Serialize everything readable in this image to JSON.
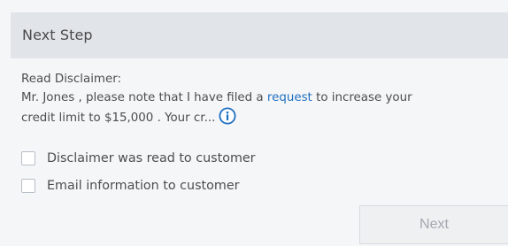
{
  "header": {
    "title": "Next Step"
  },
  "disclaimer": {
    "label": "Read Disclaimer:",
    "text_part1": "Mr. Jones , please note that I have filed a ",
    "link_text": "request",
    "text_part2": " to increase your",
    "text_line2": "credit limit to $15,000 . Your cr...",
    "info_icon": "info-circle-icon"
  },
  "checkboxes": [
    {
      "label": "Disclaimer was read to customer",
      "checked": false
    },
    {
      "label": "Email information to customer",
      "checked": false
    }
  ],
  "actions": {
    "next_label": "Next"
  },
  "colors": {
    "accent": "#1f6fc1",
    "header_bg": "#e1e5e9"
  }
}
